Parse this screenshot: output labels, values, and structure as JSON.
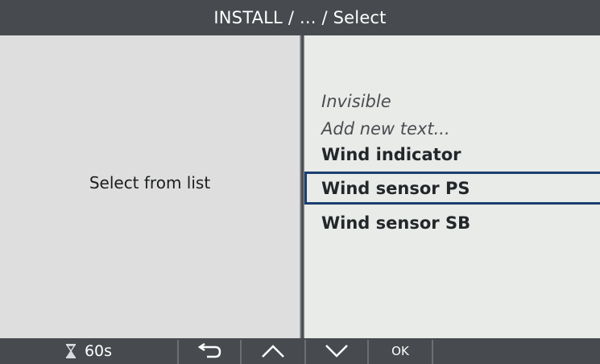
{
  "titlebar": {
    "path": "INSTALL / ... / Select"
  },
  "left_pane": {
    "prompt": "Select from list"
  },
  "list": {
    "items": [
      {
        "label": "Invisible",
        "style": "italic"
      },
      {
        "label": "Add new text...",
        "style": "italic"
      },
      {
        "label": "Wind indicator",
        "style": "bold"
      },
      {
        "label": "Wind sensor PS",
        "style": "bold",
        "selected": true
      },
      {
        "label": "Wind sensor SB",
        "style": "bold"
      }
    ]
  },
  "footer": {
    "timer_icon": "hourglass-icon",
    "timer_value": "60s",
    "back_icon": "back-arrow-icon",
    "up_icon": "chevron-up-icon",
    "down_icon": "chevron-down-icon",
    "ok_label": "OK"
  },
  "colors": {
    "header_bg": "#474b4f",
    "selection_border": "#1b3f6e",
    "left_pane_bg": "#dedede",
    "right_pane_bg": "#e9ebe9"
  }
}
